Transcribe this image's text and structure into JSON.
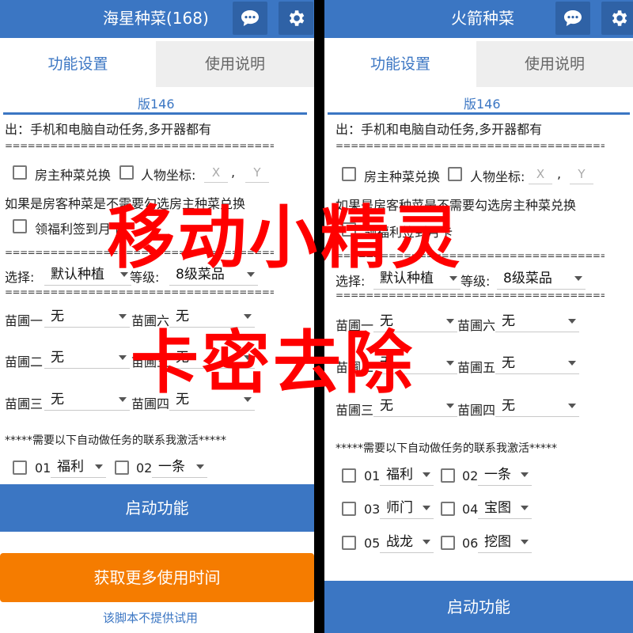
{
  "left": {
    "title": "海星种菜(168)",
    "tabs": [
      "功能设置",
      "使用说明"
    ],
    "version": "版146",
    "desc": "出：手机和电脑自动任务,多开器都有",
    "sep": "=======================================",
    "opt_exchange": "房主种菜兑换",
    "opt_coord": "人物坐标:",
    "x_placeholder": "X",
    "comma": ",",
    "y_placeholder": "Y",
    "hint": "如果是房客种菜是不需要勾选房主种菜兑换",
    "opt_checkin": "领福利签到月卡",
    "select_label": "选择:",
    "select_value": "默认种植",
    "level_label": "等级:",
    "level_value": "8级菜品",
    "plots": [
      {
        "label": "苗圃一",
        "value": "无"
      },
      {
        "label": "苗圃六",
        "value": "无"
      },
      {
        "label": "苗圃二",
        "value": "无"
      },
      {
        "label": "苗圃五",
        "value": "无"
      },
      {
        "label": "苗圃三",
        "value": "无"
      },
      {
        "label": "苗圃四",
        "value": "无"
      }
    ],
    "activation": "*****需要以下自动做任务的联系我激活*****",
    "tasks": [
      {
        "num": "01",
        "value": "福利"
      },
      {
        "num": "02",
        "value": "一条"
      }
    ],
    "start_button": "启动功能",
    "more_time_button": "获取更多使用时间",
    "no_trial": "该脚本不提供试用"
  },
  "right": {
    "title": "火箭种菜",
    "tabs": [
      "功能设置",
      "使用说明"
    ],
    "version": "版146",
    "desc": "出：手机和电脑自动任务,多开器都有",
    "sep": "=======================================",
    "opt_exchange": "房主种菜兑换",
    "opt_coord": "人物坐标:",
    "x_placeholder": "X",
    "comma": ",",
    "y_placeholder": "Y",
    "hint": "如果是房客种菜是不需要勾选房主种菜兑换",
    "opt_checkin": "领福利签到月卡",
    "select_label": "选择:",
    "select_value": "默认种植",
    "level_label": "等级:",
    "level_value": "8级菜品",
    "plots": [
      {
        "label": "苗圃一",
        "value": "无"
      },
      {
        "label": "苗圃六",
        "value": "无"
      },
      {
        "label": "苗圃二",
        "value": "无"
      },
      {
        "label": "苗圃五",
        "value": "无"
      },
      {
        "label": "苗圃三",
        "value": "无"
      },
      {
        "label": "苗圃四",
        "value": "无"
      }
    ],
    "activation": "*****需要以下自动做任务的联系我激活*****",
    "tasks": [
      {
        "num": "01",
        "value": "福利"
      },
      {
        "num": "02",
        "value": "一条"
      },
      {
        "num": "03",
        "value": "师门"
      },
      {
        "num": "04",
        "value": "宝图"
      },
      {
        "num": "05",
        "value": "战龙"
      },
      {
        "num": "06",
        "value": "挖图"
      }
    ],
    "start_button": "启动功能"
  },
  "watermark": {
    "line1": "移动小精灵",
    "line2": "卡密去除"
  },
  "colors": {
    "header": "#3b76c3",
    "start_button": "#3b76c3",
    "more_time_button": "#f57c00",
    "watermark": "#ff0000"
  },
  "icons": [
    "chat-icon",
    "gear-icon"
  ]
}
